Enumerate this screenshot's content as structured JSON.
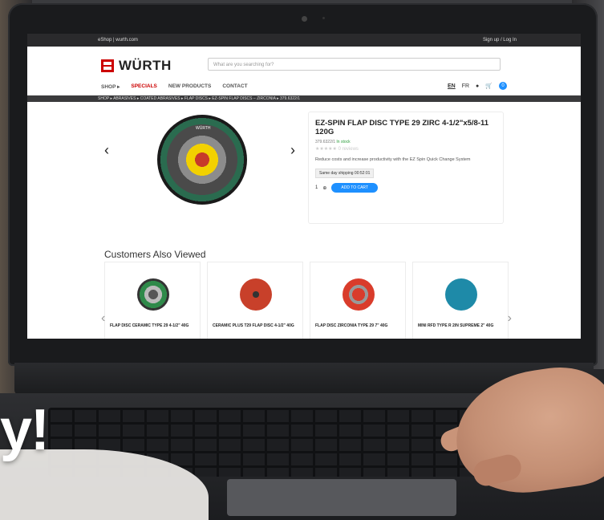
{
  "site": {
    "topbar_left": "eShop | wurth.com",
    "topbar_right": "Sign up / Log In",
    "logo_text": "WÜRTH",
    "search_placeholder": "What are you searching for?",
    "nav": [
      "SHOP ▸",
      "SPECIALS",
      "NEW PRODUCTS",
      "CONTACT"
    ],
    "lang_en": "EN",
    "lang_fr": "FR",
    "cart_count": "0",
    "breadcrumb": "SHOP ▸ ABRASIVES ▸ COATED ABRASIVES ▸ FLAP DISCS ▸ EZ-SPIN FLAP DISCS – ZIRCONIA ▸ 379.6322/1"
  },
  "product": {
    "title": "EZ-SPIN FLAP DISC TYPE 29 ZIRC 4-1/2\"x5/8-11 120G",
    "sku": "379.6322/1",
    "stock": "In stock",
    "rating_text": "0 reviews",
    "description": "Reduce costs and increase productivity with the EZ Spin Quick Change System",
    "shipping": "Same day shipping 00:52:01",
    "qty": "1",
    "add_to_cart": "ADD TO CART",
    "disc_label": "WÜRTH",
    "brand_color": "#cc0000",
    "accent_color": "#1e90ff"
  },
  "customers_also_viewed": {
    "title": "Customers Also Viewed",
    "items": [
      {
        "name": "FLAP DISC CERAMIC TYPE 29 4-1/2\" 40G",
        "color": "#2f8a4a"
      },
      {
        "name": "CERAMIC PLUS T29 FLAP DISC 4-1/2\" 40G",
        "color": "#c8402a"
      },
      {
        "name": "FLAP DISC ZIRCONIA TYPE 29 7\" 40G",
        "color": "#d93c2b"
      },
      {
        "name": "MINI RFD TYPE R 2IN SUPREME 2\" 40G",
        "color": "#1e8aa8"
      }
    ]
  },
  "promo_fragment": "y!"
}
